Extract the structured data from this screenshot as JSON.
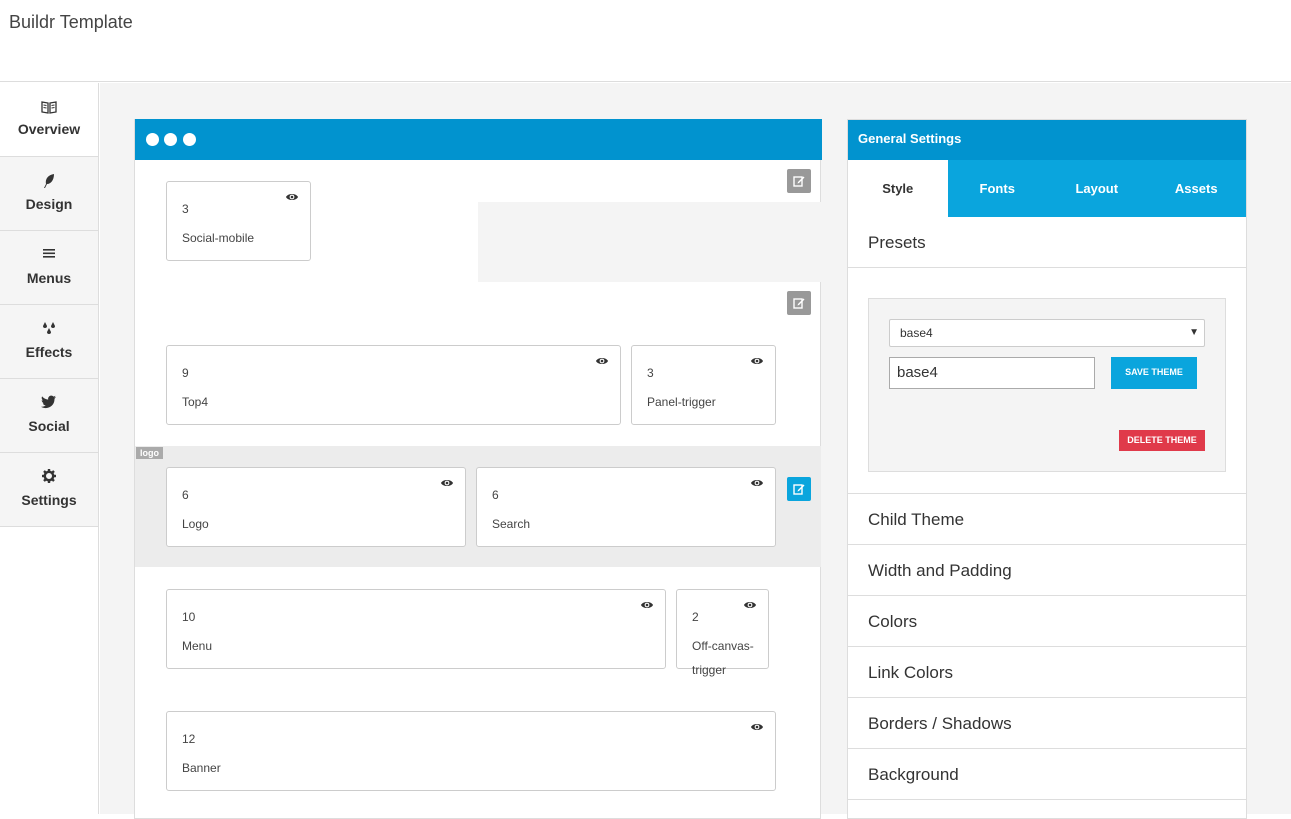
{
  "app": {
    "title": "Buildr Template"
  },
  "sidebar": {
    "items": [
      {
        "label": "Overview",
        "icon": "book-icon"
      },
      {
        "label": "Design",
        "icon": "feather-icon"
      },
      {
        "label": "Menus",
        "icon": "menu-icon"
      },
      {
        "label": "Effects",
        "icon": "droplets-icon"
      },
      {
        "label": "Social",
        "icon": "twitter-icon"
      },
      {
        "label": "Settings",
        "icon": "gear-icon"
      }
    ]
  },
  "canvas": {
    "modules": [
      {
        "size": "3",
        "name": "Social-mobile"
      },
      {
        "size": "9",
        "name": "Top4"
      },
      {
        "size": "3",
        "name": "Panel-trigger"
      },
      {
        "size": "6",
        "name": "Logo"
      },
      {
        "size": "6",
        "name": "Search"
      },
      {
        "size": "10",
        "name": "Menu"
      },
      {
        "size": "2",
        "name": "Off-canvas-trigger"
      },
      {
        "size": "12",
        "name": "Banner"
      }
    ],
    "row_tag": "logo"
  },
  "panel": {
    "title": "General Settings",
    "tabs": [
      "Style",
      "Fonts",
      "Layout",
      "Assets"
    ],
    "presets": {
      "title": "Presets",
      "selected": "base4",
      "name_value": "base4",
      "save_label": "SAVE THEME",
      "delete_label": "DELETE THEME"
    },
    "sections": [
      "Child Theme",
      "Width and Padding",
      "Colors",
      "Link Colors",
      "Borders / Shadows",
      "Background"
    ]
  },
  "colors": {
    "brand_blue": "#0193cf",
    "tab_blue": "#0aa5dd",
    "danger": "#e03a4a"
  }
}
